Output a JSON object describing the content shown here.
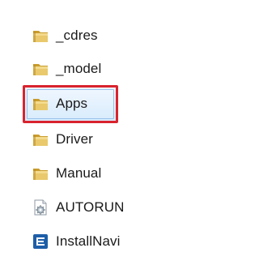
{
  "files": [
    {
      "label": "_cdres",
      "icon": "folder-icon"
    },
    {
      "label": "_model",
      "icon": "folder-icon"
    },
    {
      "label": "Apps",
      "icon": "folder-icon",
      "selected": true
    },
    {
      "label": "Driver",
      "icon": "folder-icon"
    },
    {
      "label": "Manual",
      "icon": "folder-icon"
    },
    {
      "label": "AUTORUN",
      "icon": "settings-file-icon"
    },
    {
      "label": "InstallNavi",
      "icon": "application-icon"
    }
  ],
  "colors": {
    "folder": "#e7c15d",
    "folder_dark": "#c99d2d",
    "highlight": "#d9232e",
    "selection": "#cde6fb",
    "app_icon": "#1d5ea8"
  }
}
